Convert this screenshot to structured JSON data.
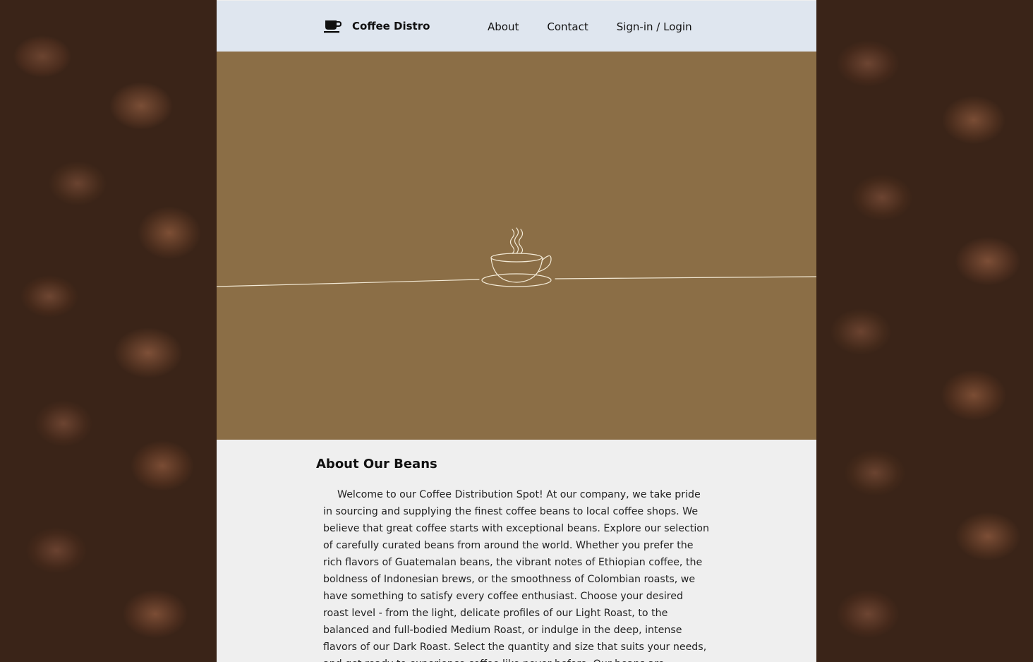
{
  "navbar": {
    "brand": "Coffee Distro",
    "brand_icon": "coffee-cup-icon",
    "links": [
      "About",
      "Contact",
      "Sign-in / Login"
    ]
  },
  "hero": {
    "background_color": "#8b6e46",
    "illustration": "coffee-cup-line-icon"
  },
  "about": {
    "title": "About Our Beans",
    "body": "Welcome to our Coffee Distribution Spot! At our company, we take pride in sourcing and supplying the finest coffee beans to local coffee shops. We believe that great coffee starts with exceptional beans. Explore our selection of carefully curated beans from around the world. Whether you prefer the rich flavors of Guatemalan beans, the vibrant notes of Ethiopian coffee, the boldness of Indonesian brews, or the smoothness of Colombian roasts, we have something to satisfy every coffee enthusiast. Choose your desired roast level - from the light, delicate profiles of our Light Roast, to the balanced and full-bodied Medium Roast, or indulge in the deep, intense flavors of our Dark Roast. Select the quantity and size that suits your needs, and get ready to experience coffee like never before. Our beans are available in various"
  }
}
